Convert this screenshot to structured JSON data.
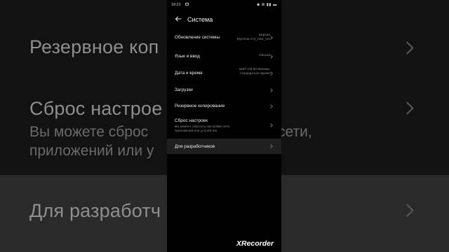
{
  "status_bar": {
    "time": "18:21",
    "icons": "◆ ⊠ ▮▮ ▬"
  },
  "header": {
    "title": "Система"
  },
  "settings": [
    {
      "label": "Обновление системы",
      "value": "Версия MyOS11.0.0_AS2_UA"
    },
    {
      "label": "Язык и ввод",
      "value": "Gboard"
    },
    {
      "label": "Дата и время",
      "value": "GMT+03:00 Москва, стандартное время"
    },
    {
      "label": "Загрузки"
    },
    {
      "label": "Резервное копирование"
    },
    {
      "label": "Сброс настроек",
      "description": "Вы можете сбросить настройки сети, приложений или устройства"
    },
    {
      "label": "Для разработчиков"
    }
  ],
  "background": {
    "line1": "Резервное коп",
    "line2": "Сброс настрое",
    "line3": "Вы можете сброс",
    "line3b": "сети,",
    "line4": "приложений или у",
    "line5": "Для разработч"
  },
  "watermark": {
    "text": "XRecorder"
  }
}
